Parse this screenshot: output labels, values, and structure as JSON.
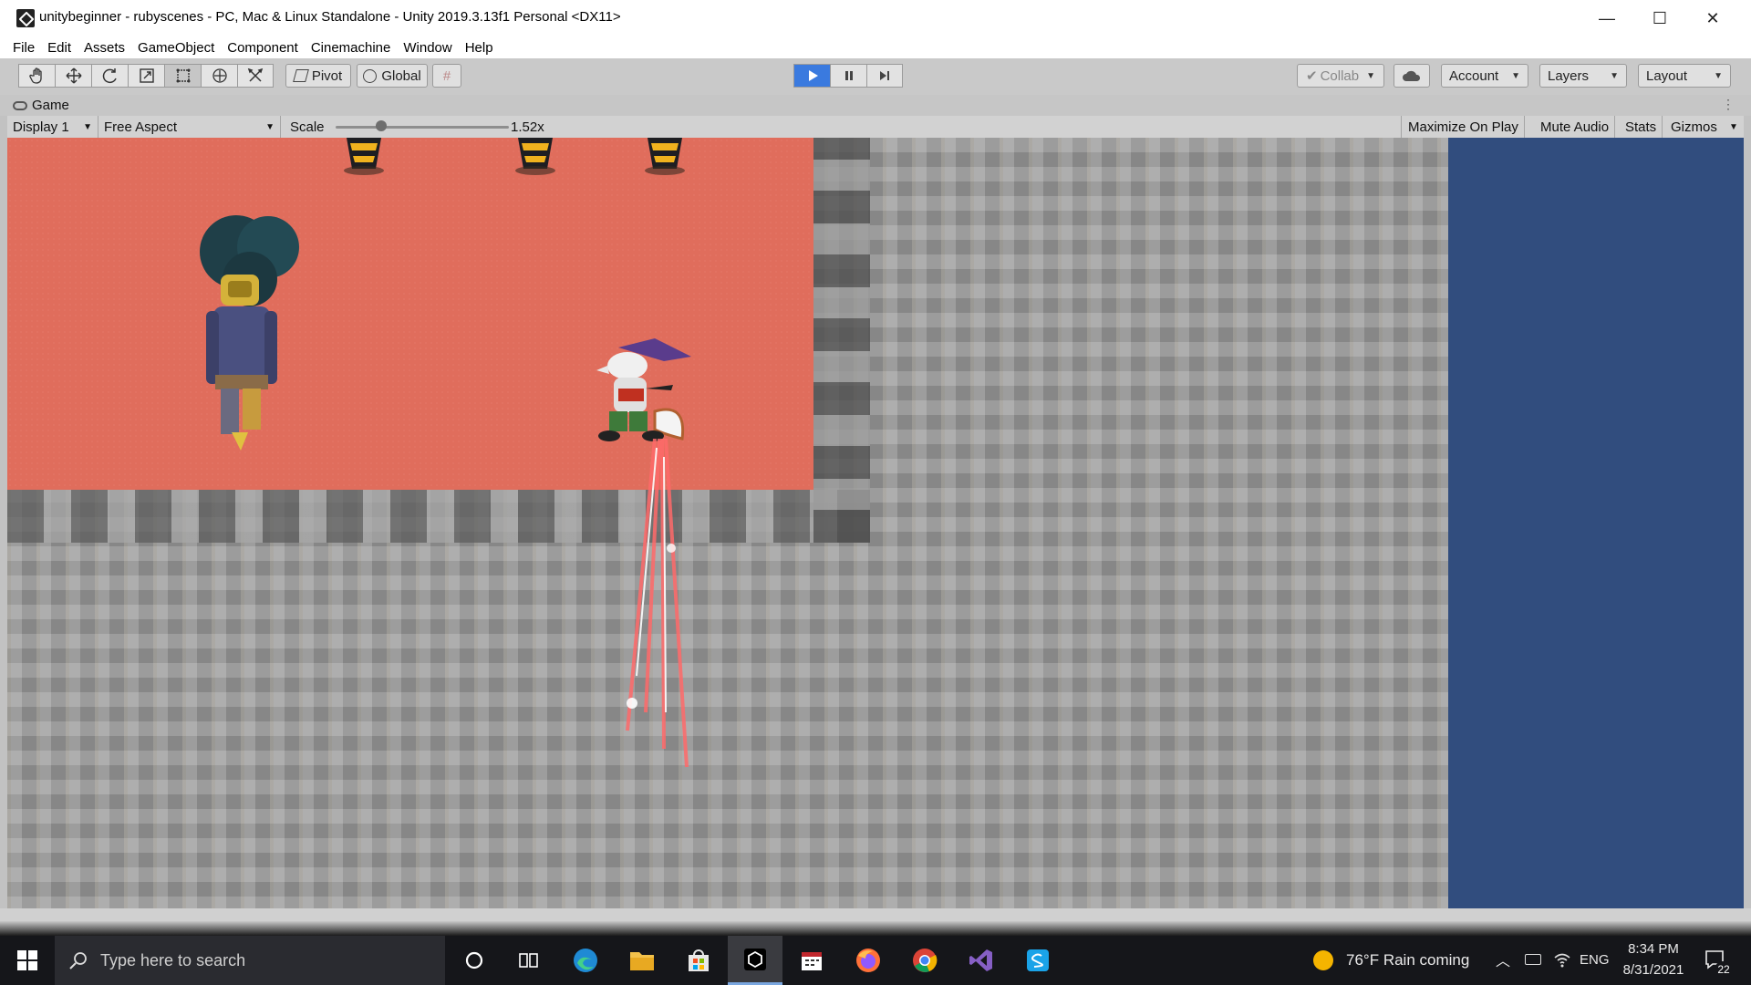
{
  "window": {
    "title": "unitybeginner - rubyscenes - PC, Mac & Linux Standalone - Unity 2019.3.13f1 Personal <DX11>",
    "minimize": "—",
    "maximize": "☐",
    "close": "✕"
  },
  "menu": [
    "File",
    "Edit",
    "Assets",
    "GameObject",
    "Component",
    "Cinemachine",
    "Window",
    "Help"
  ],
  "toolbar": {
    "tools": [
      "hand-tool",
      "move-tool",
      "rotate-tool",
      "scale-tool",
      "rect-tool",
      "transform-tool",
      "custom-tool"
    ],
    "pivot_label": "Pivot",
    "global_label": "Global",
    "play_state": "playing",
    "collab_label": "Collab",
    "account_label": "Account",
    "layers_label": "Layers",
    "layout_label": "Layout",
    "accent_color": "#3a7adf"
  },
  "game_panel": {
    "tab_label": "Game",
    "display": "Display 1",
    "aspect": "Free Aspect",
    "scale_label": "Scale",
    "scale_value": "1.52x",
    "maximize_on_play": "Maximize On Play",
    "mute_audio": "Mute Audio",
    "stats": "Stats",
    "gizmos": "Gizmos",
    "colors": {
      "room_floor": "#e06d5c",
      "tiles": "#9c9c9c",
      "background": "#314d7e"
    }
  },
  "taskbar": {
    "search_placeholder": "Type here to search",
    "apps": [
      "cortana-icon",
      "task-view-icon",
      "edge-icon",
      "file-explorer-icon",
      "store-icon",
      "unity-icon",
      "calendar-icon",
      "firefox-icon",
      "chrome-icon",
      "visual-studio-icon",
      "app-s-icon"
    ],
    "active_app": "unity-icon",
    "weather": "76°F  Rain coming",
    "language": "ENG",
    "time": "8:34 PM",
    "date": "8/31/2021",
    "notifications": "22"
  }
}
